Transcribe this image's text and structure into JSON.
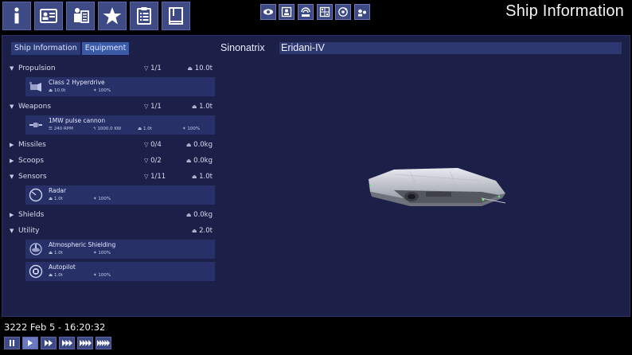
{
  "header": {
    "title": "Ship Information",
    "main_tabs": [
      {
        "icon": "info-icon"
      },
      {
        "icon": "id-card-icon"
      },
      {
        "icon": "crew-icon"
      },
      {
        "icon": "star-icon"
      },
      {
        "icon": "clipboard-icon"
      },
      {
        "icon": "book-icon"
      }
    ],
    "view_buttons": [
      {
        "icon": "eye-icon"
      },
      {
        "icon": "portrait-icon"
      },
      {
        "icon": "radar-dish-icon"
      },
      {
        "icon": "target-map-icon"
      },
      {
        "icon": "orbit-icon"
      },
      {
        "icon": "crew-pair-icon"
      }
    ]
  },
  "sub_tabs": [
    {
      "label": "Ship Information",
      "active": false
    },
    {
      "label": "Equipment",
      "active": true
    }
  ],
  "equipment": {
    "sections": [
      {
        "name": "Propulsion",
        "expanded": true,
        "slots": "1/1",
        "mass": "10.0t",
        "items": [
          {
            "name": "Class 2 Hyperdrive",
            "icon": "hyperdrive-icon",
            "stats": [
              {
                "icon": "weight",
                "value": "10.0t"
              },
              {
                "icon": "wrench",
                "value": "100%"
              }
            ]
          }
        ]
      },
      {
        "name": "Weapons",
        "expanded": true,
        "slots": "1/1",
        "mass": "1.0t",
        "items": [
          {
            "name": "1MW pulse cannon",
            "icon": "cannon-icon",
            "stats": [
              {
                "icon": "rate",
                "value": "240 RPM"
              },
              {
                "icon": "power",
                "value": "1000.0 KW"
              },
              {
                "icon": "weight",
                "value": "1.0t"
              },
              {
                "icon": "wrench",
                "value": "100%"
              }
            ]
          }
        ]
      },
      {
        "name": "Missiles",
        "expanded": false,
        "slots": "0/4",
        "mass": "0.0kg",
        "items": []
      },
      {
        "name": "Scoops",
        "expanded": false,
        "slots": "0/2",
        "mass": "0.0kg",
        "items": []
      },
      {
        "name": "Sensors",
        "expanded": true,
        "slots": "1/11",
        "mass": "1.0t",
        "items": [
          {
            "name": "Radar",
            "icon": "radar-icon",
            "stats": [
              {
                "icon": "weight",
                "value": "1.0t"
              },
              {
                "icon": "wrench",
                "value": "100%"
              }
            ]
          }
        ]
      },
      {
        "name": "Shields",
        "expanded": false,
        "slots": "",
        "mass": "0.0kg",
        "items": []
      },
      {
        "name": "Utility",
        "expanded": true,
        "slots": "",
        "mass": "2.0t",
        "items": [
          {
            "name": "Atmospheric Shielding",
            "icon": "atmo-shield-icon",
            "stats": [
              {
                "icon": "weight",
                "value": "1.0t"
              },
              {
                "icon": "wrench",
                "value": "100%"
              }
            ]
          },
          {
            "name": "Autopilot",
            "icon": "autopilot-icon",
            "stats": [
              {
                "icon": "weight",
                "value": "1.0t"
              },
              {
                "icon": "wrench",
                "value": "100%"
              }
            ]
          }
        ]
      }
    ]
  },
  "ship": {
    "type": "Sinonatrix",
    "name": "Eridani-IV"
  },
  "game_date": "3222 Feb 5 - 16:20:32",
  "time_controls": [
    {
      "icon": "pause-icon",
      "active": false
    },
    {
      "icon": "play-1x-icon",
      "active": true
    },
    {
      "icon": "play-2x-icon",
      "active": false
    },
    {
      "icon": "play-3x-icon",
      "active": false
    },
    {
      "icon": "play-4x-icon",
      "active": false
    },
    {
      "icon": "play-5x-icon",
      "active": false
    }
  ],
  "colors": {
    "panel_bg": "#1c2048",
    "button_bg": "#3d4a86",
    "item_bg": "#283068",
    "field_bg": "#2d3870"
  }
}
